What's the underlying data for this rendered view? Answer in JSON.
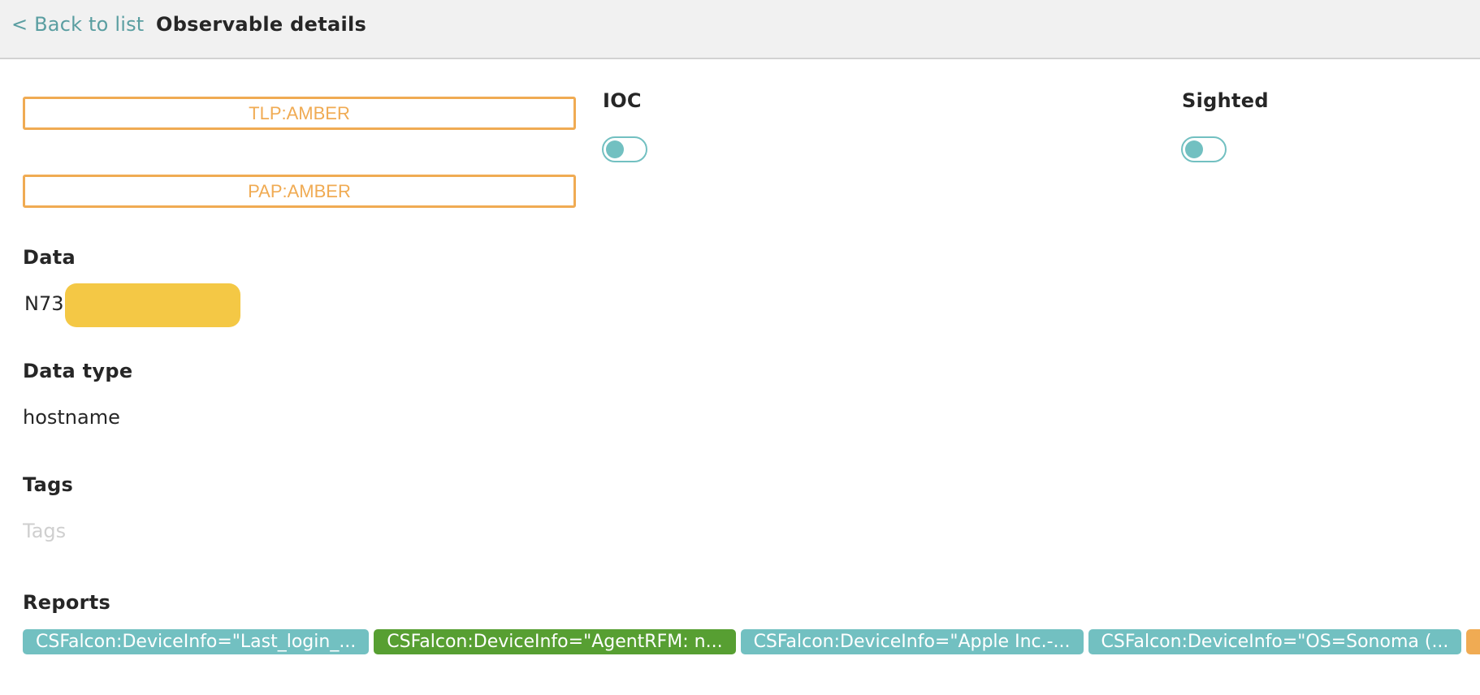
{
  "header": {
    "back_label": "< Back to list",
    "title": "Observable details"
  },
  "tlp": {
    "label": "TLP:AMBER",
    "color": "#f0ab53"
  },
  "pap": {
    "label": "PAP:AMBER",
    "color": "#f0ab53"
  },
  "ioc": {
    "label": "IOC",
    "enabled": false
  },
  "sighted": {
    "label": "Sighted",
    "enabled": false
  },
  "data": {
    "label": "Data",
    "value_visible": "N73",
    "redacted": true
  },
  "data_type": {
    "label": "Data type",
    "value": "hostname"
  },
  "tags": {
    "label": "Tags",
    "placeholder": "Tags",
    "value": ""
  },
  "reports": {
    "label": "Reports",
    "items": [
      {
        "text": "CSFalcon:DeviceInfo=\"Last_login_...",
        "color": "teal"
      },
      {
        "text": "CSFalcon:DeviceInfo=\"AgentRFM: n...",
        "color": "green"
      },
      {
        "text": "CSFalcon:DeviceInfo=\"Apple Inc.-...",
        "color": "teal"
      },
      {
        "text": "CSFalcon:DeviceInfo=\"OS=Sonoma (...",
        "color": "teal"
      },
      {
        "text": "",
        "color": "amber"
      }
    ]
  },
  "colors": {
    "accent": "#72c0c1",
    "link": "#5a9ea1",
    "amber": "#f0ab53",
    "green": "#579f32",
    "redaction": "#f4c845"
  }
}
